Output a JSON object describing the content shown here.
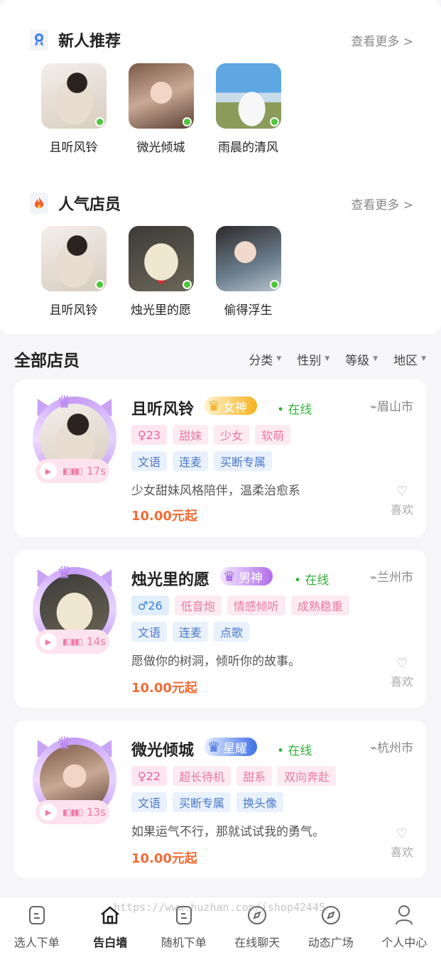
{
  "new_recommend": {
    "title": "新人推荐",
    "more": "查看更多 >",
    "icon": "ribbon-medal-icon",
    "items": [
      {
        "name": "且听风铃"
      },
      {
        "name": "微光倾城"
      },
      {
        "name": "雨晨的清风"
      }
    ]
  },
  "popular": {
    "title": "人气店员",
    "more": "查看更多 >",
    "icon": "flame-icon",
    "items": [
      {
        "name": "且听风铃"
      },
      {
        "name": "烛光里的愿"
      },
      {
        "name": "偷得浮生"
      }
    ]
  },
  "all": {
    "title": "全部店员",
    "filters": [
      "分类",
      "性别",
      "等级",
      "地区"
    ]
  },
  "cards": [
    {
      "name": "且听风铃",
      "badge": "女神",
      "online": "• 在线",
      "city": "眉山市",
      "age": "♀23",
      "traits": [
        "甜妹",
        "少女",
        "软萌"
      ],
      "services": [
        "文语",
        "连麦",
        "买断专属"
      ],
      "voice": "17s",
      "bio": "少女甜妹风格陪伴，温柔治愈系",
      "price": "10.00元起",
      "like": "喜欢"
    },
    {
      "name": "烛光里的愿",
      "badge": "男神",
      "online": "• 在线",
      "city": "兰州市",
      "age": "♂26",
      "traits": [
        "低音炮",
        "情感倾听",
        "成熟稳重"
      ],
      "services": [
        "文语",
        "连麦",
        "点歌"
      ],
      "voice": "14s",
      "bio": "愿做你的树洞，倾听你的故事。",
      "price": "10.00元起",
      "like": "喜欢"
    },
    {
      "name": "微光倾城",
      "badge": "星耀",
      "online": "• 在线",
      "city": "杭州市",
      "age": "♀22",
      "traits": [
        "超长待机",
        "甜系",
        "双向奔赴"
      ],
      "services": [
        "文语",
        "买断专属",
        "换头像"
      ],
      "voice": "13s",
      "bio": "如果运气不行，那就试试我的勇气。",
      "price": "10.00元起",
      "like": "喜欢"
    }
  ],
  "tabbar": [
    {
      "label": "选人下单",
      "icon": "order-doc-icon"
    },
    {
      "label": "告白墙",
      "icon": "home-icon"
    },
    {
      "label": "随机下单",
      "icon": "random-doc-icon"
    },
    {
      "label": "在线聊天",
      "icon": "compass-icon"
    },
    {
      "label": "动态广场",
      "icon": "compass-icon"
    },
    {
      "label": "个人中心",
      "icon": "user-icon"
    }
  ],
  "watermark": "https://www.huzhan.com/ishop42445",
  "colors": {
    "online_green": "#35b13a",
    "price_orange": "#f26b35",
    "goddess_gold": "#f5b21f",
    "god_purple": "#b16be9",
    "star_blue": "#3d6fe5"
  }
}
